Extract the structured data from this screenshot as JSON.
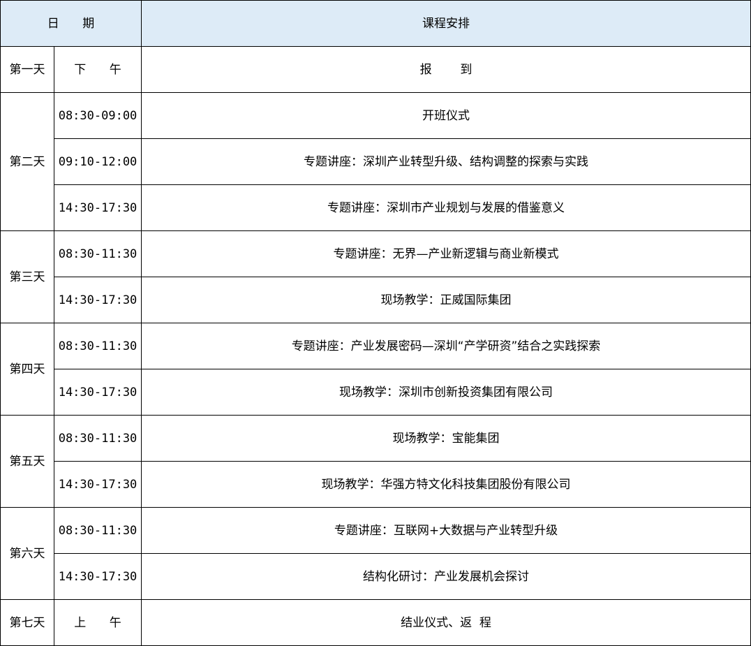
{
  "header": {
    "date_label": "日 期",
    "schedule_label": "课程安排"
  },
  "days": [
    {
      "day": "第一天",
      "sessions": [
        {
          "time": "下 午",
          "content": "报  到"
        }
      ]
    },
    {
      "day": "第二天",
      "sessions": [
        {
          "time": "08:30-09:00",
          "content": "开班仪式"
        },
        {
          "time": "09:10-12:00",
          "content": "专题讲座：深圳产业转型升级、结构调整的探索与实践"
        },
        {
          "time": "14:30-17:30",
          "content": "专题讲座：深圳市产业规划与发展的借鉴意义"
        }
      ]
    },
    {
      "day": "第三天",
      "sessions": [
        {
          "time": "08:30-11:30",
          "content": "专题讲座：无界—产业新逻辑与商业新模式"
        },
        {
          "time": "14:30-17:30",
          "content": "现场教学：正威国际集团"
        }
      ]
    },
    {
      "day": "第四天",
      "sessions": [
        {
          "time": "08:30-11:30",
          "content": "专题讲座：产业发展密码—深圳“产学研资”结合之实践探索"
        },
        {
          "time": "14:30-17:30",
          "content": "现场教学：深圳市创新投资集团有限公司"
        }
      ]
    },
    {
      "day": "第五天",
      "sessions": [
        {
          "time": "08:30-11:30",
          "content": "现场教学：宝能集团"
        },
        {
          "time": "14:30-17:30",
          "content": "现场教学：华强方特文化科技集团股份有限公司"
        }
      ]
    },
    {
      "day": "第六天",
      "sessions": [
        {
          "time": "08:30-11:30",
          "content": "专题讲座：互联网+大数据与产业转型升级"
        },
        {
          "time": "14:30-17:30",
          "content": "结构化研讨：产业发展机会探讨"
        }
      ]
    },
    {
      "day": "第七天",
      "sessions": [
        {
          "time": "上 午",
          "content": "结业仪式、返  程"
        }
      ]
    }
  ],
  "colors": {
    "header_background": "#ddebf7",
    "border": "#000000"
  }
}
